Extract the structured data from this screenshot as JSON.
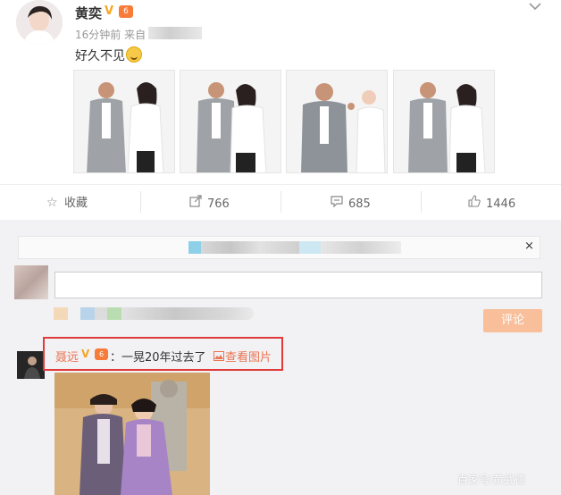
{
  "post": {
    "author": "黄奕",
    "verified_badge": "V",
    "level_badge": "6",
    "time_prefix": "16分钟前 来自",
    "text": "好久不见",
    "menu_icon": "chevron-down-icon"
  },
  "actions": {
    "favorite_label": "收藏",
    "repost_count": "766",
    "comment_count": "685",
    "like_count": "1446"
  },
  "comment_box": {
    "close_glyph": "×",
    "submit_label": "评论"
  },
  "comment": {
    "user": "聂远",
    "verified_badge": "V",
    "level_badge": "6",
    "text": "：一晃20年过去了",
    "view_image_label": "查看图片"
  },
  "watermark": "百家号/黄武德",
  "colors": {
    "link_orange": "#eb7350",
    "verified_gold": "#f5a623",
    "submit_disabled": "#f8bf9a",
    "highlight_red": "#e03a3a"
  }
}
